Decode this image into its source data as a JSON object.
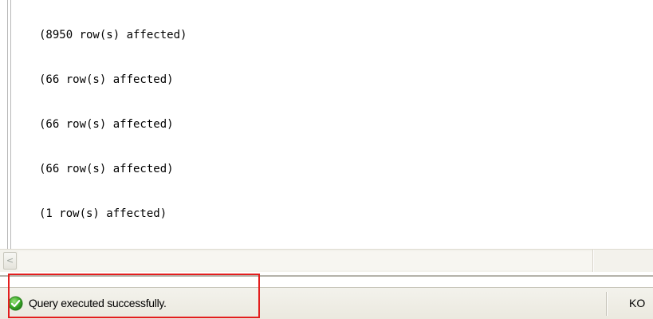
{
  "messages": [
    "(8950 row(s) affected)",
    "(66 row(s) affected)",
    "(66 row(s) affected)",
    "(66 row(s) affected)",
    "(1 row(s) affected)"
  ],
  "scrollbar": {
    "left_arrow": "<"
  },
  "statusbar": {
    "status_icon": "success-check-icon",
    "status_text": "Query executed successfully.",
    "server_text": "KO"
  },
  "colors": {
    "highlight": "#e31e1e",
    "success_green": "#3fae2a",
    "statusbar_bg": "#eceae0"
  }
}
